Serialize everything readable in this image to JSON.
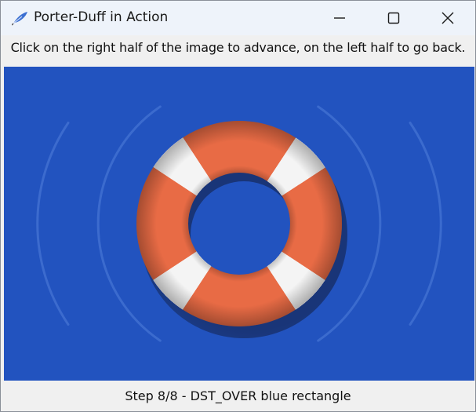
{
  "window": {
    "title": "Porter-Duff in Action",
    "app_icon": "feather-icon",
    "controls": [
      "minimize-icon",
      "maximize-icon",
      "close-icon"
    ]
  },
  "instruction": "Click on the right half of the image to advance, on the left half to go back.",
  "status": "Step 8/8 - DST_OVER blue rectangle",
  "colors": {
    "canvas_background": "#2253bf",
    "ring_orange": "#e86b45",
    "ring_white": "#f4f4f4",
    "shadow": "#1b3a86",
    "titlebar": "#eef3fa"
  }
}
